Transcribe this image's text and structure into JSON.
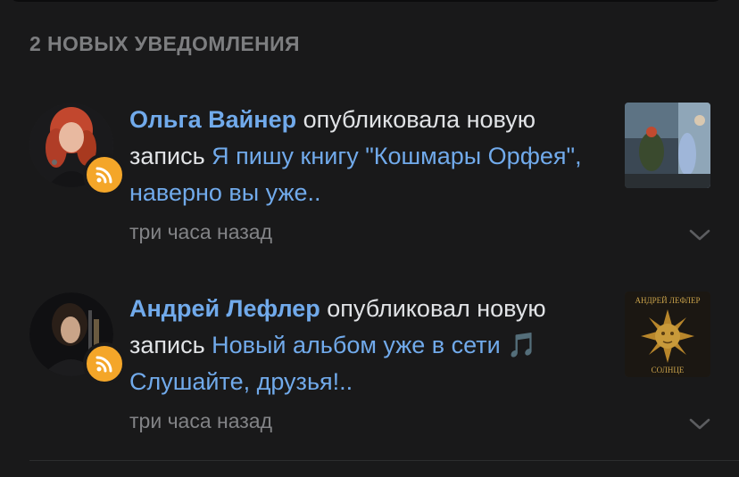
{
  "section": {
    "title": "2 НОВЫХ УВЕДОМЛЕНИЯ"
  },
  "notifications": [
    {
      "author": "Ольга Вайнер",
      "action": " опубликовала новую запись ",
      "post": "Я пишу книгу \"Кошмары Орфея\", наверно вы уже..",
      "time": "три часа назад",
      "badge_icon": "rss-icon"
    },
    {
      "author": "Андрей Лефлер",
      "action": " опубликовал новую запись ",
      "post": "Новый альбом уже в сети 🎵 Слушайте, друзья!..",
      "time": "три часа назад",
      "badge_icon": "rss-icon",
      "thumb_top_text": "АНДРЕЙ ЛЕФЛЕР",
      "thumb_bottom_text": "СОЛНЦЕ"
    }
  ],
  "colors": {
    "background": "#19191a",
    "link": "#71aaeb",
    "text": "#e1e3e6",
    "secondary": "#828386",
    "badge": "#f4a629"
  }
}
